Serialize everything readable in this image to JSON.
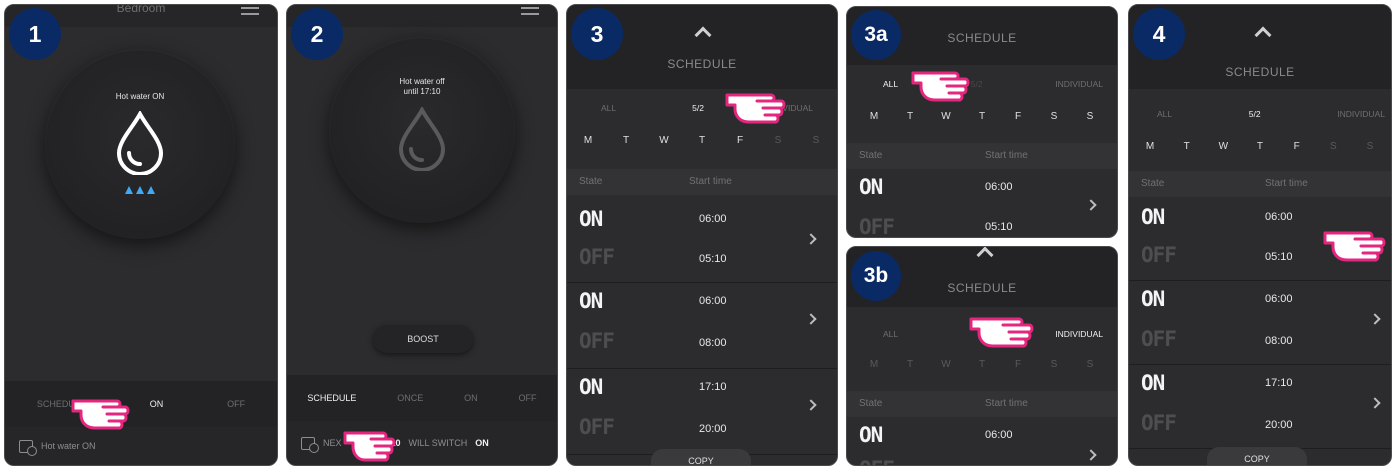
{
  "panels": {
    "p1": {
      "badge": "1",
      "top_title": "Bedroom",
      "dial_text": "Hot water ON",
      "modes": [
        "SCHEDULE",
        "ON",
        "OFF"
      ],
      "footer": "Hot water ON"
    },
    "p2": {
      "badge": "2",
      "dial_line1": "Hot water off",
      "dial_line2": "until 17:10",
      "boost": "BOOST",
      "modes": [
        "SCHEDULE",
        "ONCE",
        "ON",
        "OFF"
      ],
      "footer_pre": "NEX",
      "footer_time": "17:10",
      "footer_mid": "WILL SWITCH",
      "footer_state": "ON"
    },
    "p3": {
      "badge": "3",
      "title": "SCHEDULE",
      "tabs": [
        "ALL",
        "5/2",
        "IVIDUAL"
      ],
      "days": [
        "M",
        "T",
        "W",
        "T",
        "F",
        "S",
        "S"
      ],
      "col_state": "State",
      "col_start": "Start time",
      "entries": [
        {
          "on": "ON",
          "on_time": "06:00",
          "off": "OFF",
          "off_time": "05:10"
        },
        {
          "on": "ON",
          "on_time": "06:00",
          "off": "OFF",
          "off_time": "08:00"
        },
        {
          "on": "ON",
          "on_time": "17:10",
          "off": "OFF",
          "off_time": "20:00"
        }
      ],
      "copy": "COPY"
    },
    "p3a": {
      "badge": "3a",
      "title": "SCHEDULE",
      "tabs": [
        "ALL",
        "5/2",
        "INDIVIDUAL"
      ],
      "days": [
        "M",
        "T",
        "W",
        "T",
        "F",
        "S",
        "S"
      ],
      "col_state": "State",
      "col_start": "Start time",
      "on": "ON",
      "on_time": "06:00",
      "off": "OFF",
      "off_time": "05:10"
    },
    "p3b": {
      "badge": "3b",
      "title": "SCHEDULE",
      "tabs": [
        "ALL",
        "INDIVIDUAL"
      ],
      "days": [
        "M",
        "T",
        "W",
        "T",
        "F",
        "S",
        "S"
      ],
      "col_state": "State",
      "col_start": "Start time",
      "on": "ON",
      "on_time": "06:00",
      "off": "OFF"
    },
    "p4": {
      "badge": "4",
      "title": "SCHEDULE",
      "tabs": [
        "ALL",
        "5/2",
        "INDIVIDUAL"
      ],
      "days": [
        "M",
        "T",
        "W",
        "T",
        "F",
        "S",
        "S"
      ],
      "col_state": "State",
      "col_start": "Start time",
      "entries": [
        {
          "on": "ON",
          "on_time": "06:00",
          "off": "OFF",
          "off_time": "05:10"
        },
        {
          "on": "ON",
          "on_time": "06:00",
          "off": "OFF",
          "off_time": "08:00"
        },
        {
          "on": "ON",
          "on_time": "17:10",
          "off": "OFF",
          "off_time": "20:00"
        }
      ],
      "copy": "COPY"
    }
  },
  "colors": {
    "badge": "#0a2a66",
    "pointer_hand": "#e3277f",
    "flame": "#3fa9f5",
    "screen": "#2c2c2e"
  },
  "icons": [
    "water-drop-icon",
    "flame-icon",
    "pointer-hand-icon",
    "calendar-clock-icon",
    "chevron-up-icon",
    "chevron-right-icon",
    "menu-icon"
  ]
}
